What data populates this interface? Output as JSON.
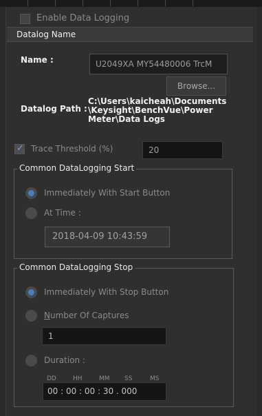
{
  "enable_logging": {
    "label": "Enable Data Logging",
    "checked": false
  },
  "datalog_section": {
    "title": "Datalog Name"
  },
  "name": {
    "label": "Name :",
    "value": "U2049XA MY54480006 TrcM"
  },
  "browse": {
    "label": "Browse..."
  },
  "path": {
    "label": "Datalog Path :",
    "line1": "C:\\Users\\kaicheah\\Documents",
    "line2": "\\Keysight\\BenchVue\\Power",
    "line3": "Meter\\Data Logs"
  },
  "trace_threshold": {
    "label": "Trace Threshold (%)",
    "checked": true,
    "value": "20"
  },
  "start_group": {
    "title": "Common DataLogging Start",
    "opt_immediate": "Immediately With Start Button",
    "opt_time": "At Time :",
    "time_value": "2018-04-09 10:43:59"
  },
  "stop_group": {
    "title": "Common DataLogging Stop",
    "opt_immediate": "Immediately With Stop Button",
    "opt_captures_first": "N",
    "opt_captures_rest": "umber Of Captures",
    "captures_value": "1",
    "opt_duration": "Duration :",
    "duration_labels": {
      "dd": "DD",
      "hh": "HH",
      "mm": "MM",
      "ss": "SS",
      "ms": "MS"
    },
    "duration_value": "00 : 00 : 00 : 30 . 000"
  },
  "colors": {
    "accent": "#3f82c4",
    "panel": "#2f2f2f",
    "field": "#1e1e1e"
  }
}
